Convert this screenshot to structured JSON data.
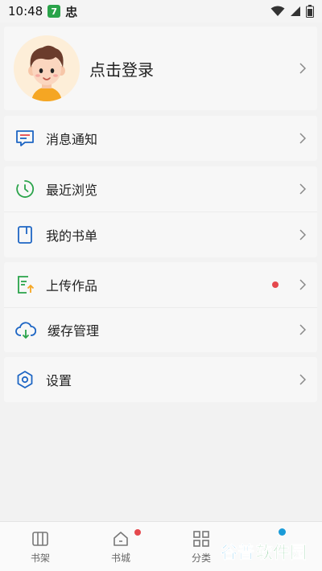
{
  "status_bar": {
    "time": "10:48",
    "app_badge": "7",
    "tts_glyph": "忠"
  },
  "profile": {
    "login_label": "点击登录"
  },
  "menu": {
    "messages": "消息通知",
    "recent": "最近浏览",
    "booklist": "我的书单",
    "upload": "上传作品",
    "cache": "缓存管理",
    "settings": "设置"
  },
  "tabs": {
    "bookshelf": "书架",
    "bookstore": "书城",
    "category": "分类"
  },
  "watermark": "谷普软件园",
  "colors": {
    "accent_blue": "#1a9bd8",
    "badge_red": "#e5484d",
    "icon_green": "#2aa34a",
    "icon_blue": "#1e66c4"
  }
}
